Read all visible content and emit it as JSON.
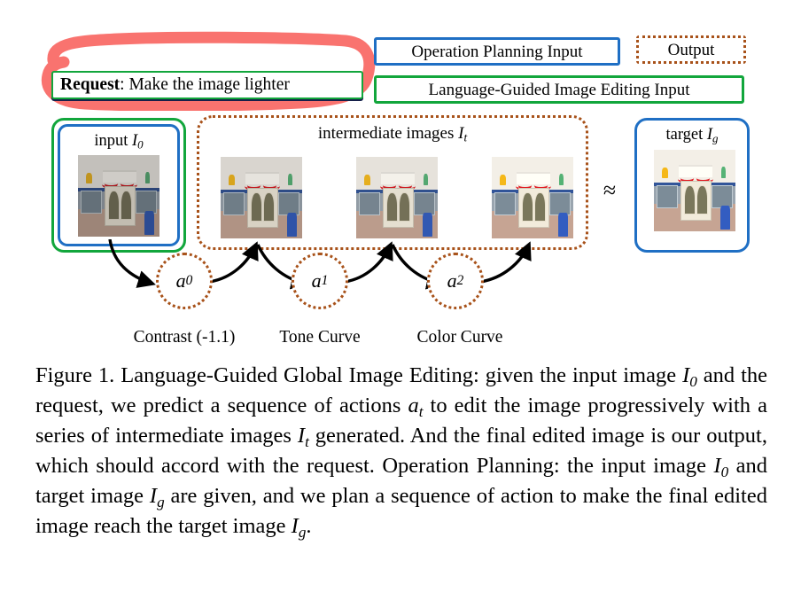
{
  "figure": {
    "request": {
      "label": "Request",
      "separator": ":",
      "text": "Make the image lighter"
    },
    "legend": [
      {
        "id": "operation-planning-input",
        "text": "Operation Planning Input",
        "style": "blue",
        "color": "#1f6fc4"
      },
      {
        "id": "output",
        "text": "Output",
        "style": "dotted",
        "color": "#a8521a"
      },
      {
        "id": "language-guided-image-editing-input",
        "text": "Language-Guided Image Editing Input",
        "style": "green",
        "color": "#12a63c"
      }
    ],
    "input_panel": {
      "title": "input",
      "variable": "I",
      "subscript": "0",
      "outer_border_color": "#12a63c",
      "inner_border_color": "#1f6fc4"
    },
    "intermediate_panel": {
      "title": "intermediate images",
      "variable": "I",
      "subscript": "t",
      "border_color": "#a8521a",
      "image_count": 3
    },
    "target_panel": {
      "title": "target",
      "variable": "I",
      "subscript": "g",
      "border_color": "#1f6fc4"
    },
    "approx_symbol": "≈",
    "actions": [
      {
        "node": "a",
        "subscript": "0",
        "label": "Contrast (-1.1)"
      },
      {
        "node": "a",
        "subscript": "1",
        "label": "Tone Curve"
      },
      {
        "node": "a",
        "subscript": "2",
        "label": "Color Curve"
      }
    ],
    "highlight": {
      "name": "red-marker-annotation",
      "color": "#f9736f"
    }
  },
  "caption": {
    "line1_prefix": "Figure 1. Language-Guided Global Image Editing:",
    "full_text": "Figure 1. Language-Guided Global Image Editing: given the input image I0 and the request, we predict a sequence of actions at to edit the image progressively with a series of intermediate images It generated. And the final edited image is our output, which should accord with the request. Operation Planning: the input image I0 and target image Ig are given, and we plan a sequence of action to make the final edited image reach the target image Ig.",
    "segments": [
      {
        "t": "Figure 1. Language-Guided Global Image Editing:  given the input image ",
        "i": false
      },
      {
        "t": "I",
        "i": true,
        "sub": "0"
      },
      {
        "t": " and the request, we predict a sequence of actions ",
        "i": false
      },
      {
        "t": "a",
        "i": true,
        "sub": "t"
      },
      {
        "t": " to edit the image progressively with a series of intermediate images ",
        "i": false
      },
      {
        "t": "I",
        "i": true,
        "sub": "t"
      },
      {
        "t": " generated. And the final edited image is our output, which should accord with the request. Operation Planning: the input image ",
        "i": false
      },
      {
        "t": "I",
        "i": true,
        "sub": "0"
      },
      {
        "t": " and target image ",
        "i": false
      },
      {
        "t": "I",
        "i": true,
        "sub": "g"
      },
      {
        "t": " are given, and we plan a sequence of action to make the final edited image reach the target image ",
        "i": false
      },
      {
        "t": "I",
        "i": true,
        "sub": "g"
      },
      {
        "t": ".",
        "i": false
      }
    ]
  }
}
